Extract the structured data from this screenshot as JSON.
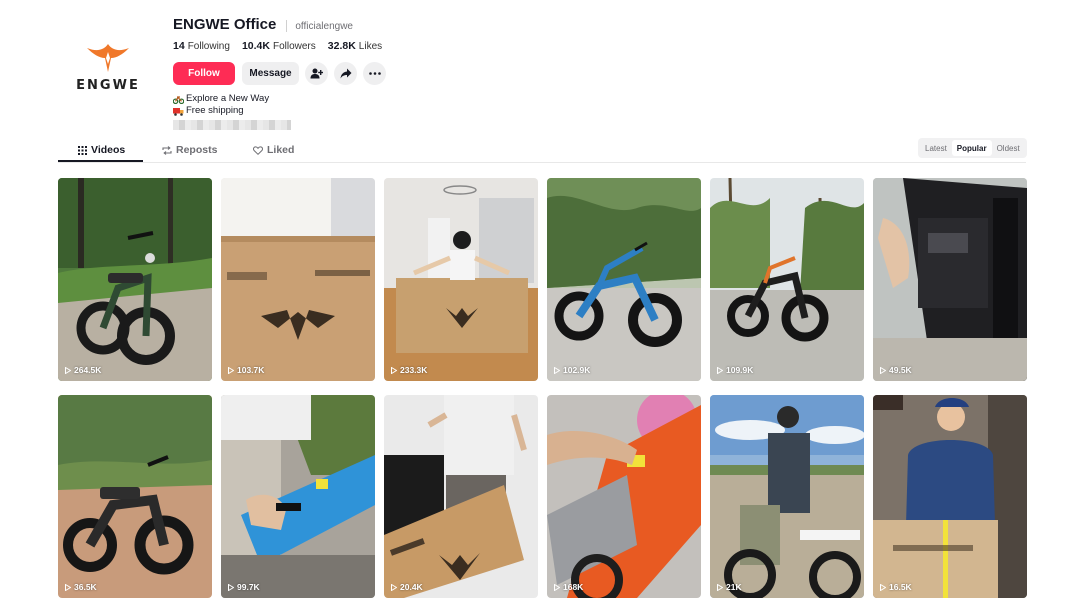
{
  "profile": {
    "display_name": "ENGWE Office",
    "handle": "officialengwe",
    "logo_wordmark": "ENGWE",
    "stats": [
      {
        "value": "14",
        "label": "Following"
      },
      {
        "value": "10.4K",
        "label": "Followers"
      },
      {
        "value": "32.8K",
        "label": "Likes"
      }
    ],
    "follow_label": "Follow",
    "message_label": "Message",
    "bio": [
      "Explore a New Way",
      "Free shipping"
    ]
  },
  "tabs": [
    {
      "label": "Videos",
      "icon": "grid-icon",
      "active": true
    },
    {
      "label": "Reposts",
      "icon": "repost-icon",
      "active": false
    },
    {
      "label": "Liked",
      "icon": "heart-icon",
      "active": false
    }
  ],
  "sort": {
    "options": [
      "Latest",
      "Popular",
      "Oldest"
    ],
    "selected": "Popular"
  },
  "videos": [
    {
      "views": "264.5K"
    },
    {
      "views": "103.7K"
    },
    {
      "views": "233.3K"
    },
    {
      "views": "102.9K"
    },
    {
      "views": "109.9K"
    },
    {
      "views": "49.5K"
    },
    {
      "views": "36.5K"
    },
    {
      "views": "99.7K"
    },
    {
      "views": "20.4K"
    },
    {
      "views": "168K"
    },
    {
      "views": "21K"
    },
    {
      "views": "16.5K"
    }
  ],
  "colors": {
    "follow": "#fe2c55",
    "logo_orange": "#f0782a",
    "text": "#161823",
    "muted": "#6e6e73"
  }
}
